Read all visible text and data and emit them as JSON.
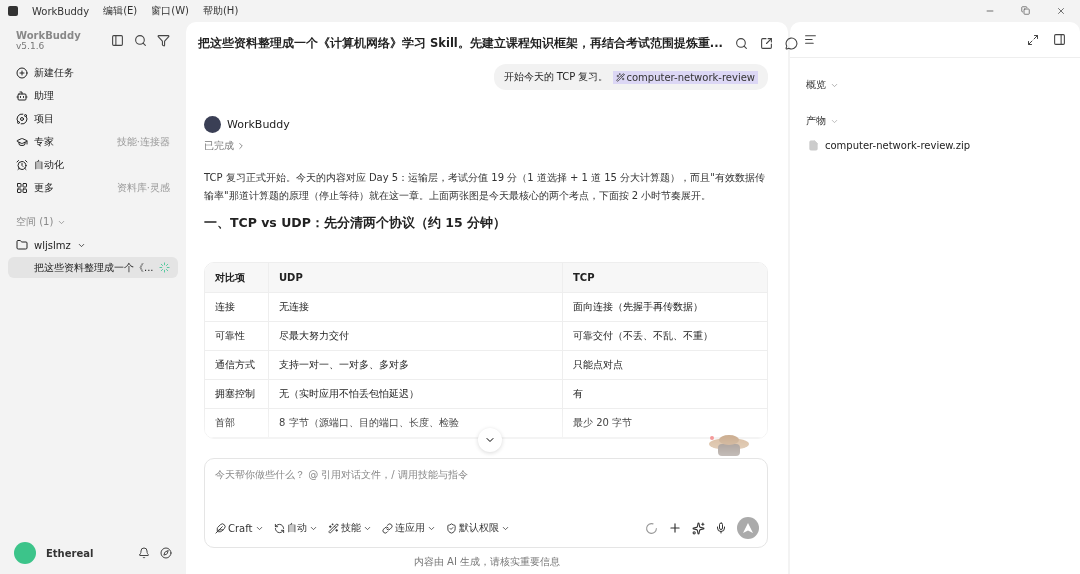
{
  "menubar": {
    "app_name": "WorkBuddy",
    "items": [
      "编辑(E)",
      "窗口(W)",
      "帮助(H)"
    ]
  },
  "sidebar": {
    "brand": "WorkBuddy",
    "version": "v5.1.6",
    "nav": [
      {
        "label": "新建任务"
      },
      {
        "label": "助理"
      },
      {
        "label": "项目"
      },
      {
        "label": "专家",
        "hint": "技能·连接器"
      },
      {
        "label": "自动化"
      },
      {
        "label": "更多",
        "hint": "资料库·灵感"
      }
    ],
    "space_label": "空间 (1)",
    "folder": {
      "name": "wljslmz",
      "expanded": true
    },
    "tasks": [
      {
        "label": "把这些资料整理成一个《...",
        "selected": true,
        "running": true
      }
    ],
    "user": "Ethereal"
  },
  "chat": {
    "title": "把这些资料整理成一个《计算机网络》学习 Skill。先建立课程知识框架，再结合考试范围提炼重...",
    "user_message": {
      "text": "开始今天的 TCP 复习。",
      "skill": "computer-network-review"
    },
    "assistant": "WorkBuddy",
    "status": "已完成",
    "paragraph": "TCP 复习正式开始。今天的内容对应 Day 5：运输层，考试分值 19 分（1 道选择 + 1 道 15 分大计算题），而且\"有效数据传输率\"那道计算题的原理（停止等待）就在这一章。上面两张图是今天最核心的两个考点，下面按 2 小时节奏展开。",
    "heading": "一、TCP vs UDP：先分清两个协议（约 15 分钟）",
    "table": {
      "columns": [
        "对比项",
        "UDP",
        "TCP"
      ],
      "rows": [
        [
          "连接",
          "无连接",
          "面向连接（先握手再传数据）"
        ],
        [
          "可靠性",
          "尽最大努力交付",
          "可靠交付（不丢、不乱、不重）"
        ],
        [
          "通信方式",
          "支持一对一、一对多、多对多",
          "只能点对点"
        ],
        [
          "拥塞控制",
          "无（实时应用不怕丢包怕延迟）",
          "有"
        ],
        [
          "首部",
          "8 字节（源端口、目的端口、长度、检验",
          "最少 20 字节"
        ]
      ]
    },
    "composer": {
      "placeholder": "今天帮你做些什么？ @ 引用对话文件，/ 调用技能与指令",
      "tools": [
        "Craft",
        "自动",
        "技能",
        "连应用",
        "默认权限"
      ]
    },
    "disclaimer": "内容由 AI 生成，请核实重要信息"
  },
  "panel": {
    "overview": "概览",
    "artifacts": "产物",
    "files": [
      "computer-network-review.zip"
    ]
  }
}
